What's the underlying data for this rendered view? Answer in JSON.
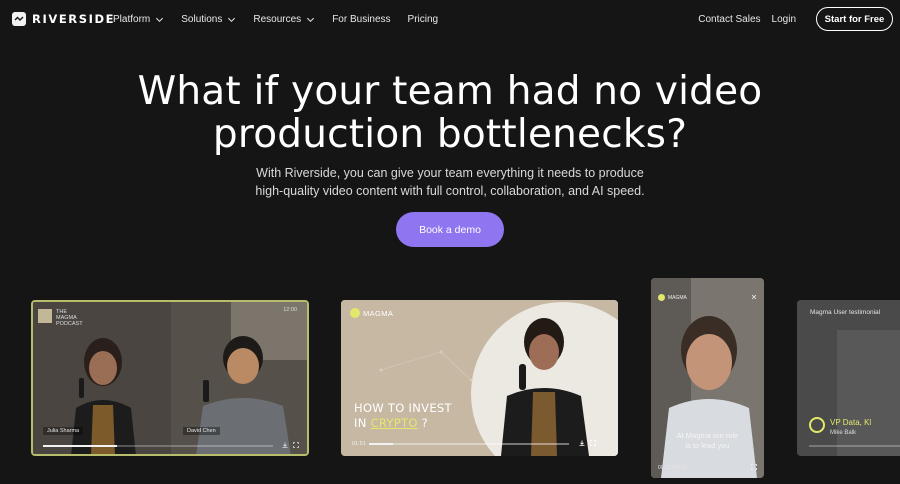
{
  "brand": {
    "name": "RIVERSIDE"
  },
  "nav": {
    "menu": [
      {
        "label": "Platform",
        "has_dropdown": true
      },
      {
        "label": "Solutions",
        "has_dropdown": true
      },
      {
        "label": "Resources",
        "has_dropdown": true
      },
      {
        "label": "For Business",
        "has_dropdown": false
      },
      {
        "label": "Pricing",
        "has_dropdown": false
      }
    ],
    "contact_sales": "Contact Sales",
    "login": "Login",
    "start_label": "Start for Free"
  },
  "hero": {
    "headline_line1": "What if your team had no video",
    "headline_line2": "production bottlenecks?",
    "sub_line1": "With Riverside, you can give your team everything it needs to produce",
    "sub_line2": "high-quality video content with full control, collaboration, and AI speed.",
    "cta_label": "Book a demo"
  },
  "cards": {
    "podcast": {
      "show_line1": "THE",
      "show_line2": "MAGMA",
      "show_line3": "PODCAST",
      "timestamp": "12:00",
      "speaker1": "Julia Sharma",
      "speaker2": "David Chen",
      "progress": 0.32
    },
    "invest": {
      "brand": "MAGMA",
      "title_line1": "HOW TO INVEST",
      "title_line2_prefix": "IN ",
      "title_highlight": "CRYPTO",
      "title_suffix": " ?",
      "time": "01:51",
      "progress": 0.12
    },
    "vertical": {
      "brand": "MAGMA",
      "caption_line1": "At Magma our role",
      "caption_line2": "is to lead you",
      "time": "00:32 / 01:25"
    },
    "testimonial": {
      "title": "Magma User testimonial",
      "name_line1": "VP Data, Kl",
      "name_line2": "Mike Balk"
    }
  },
  "colors": {
    "background": "#151515",
    "cta": "#8f75f0",
    "highlight": "#e4e86a",
    "selected_border": "#b7bd6b"
  }
}
